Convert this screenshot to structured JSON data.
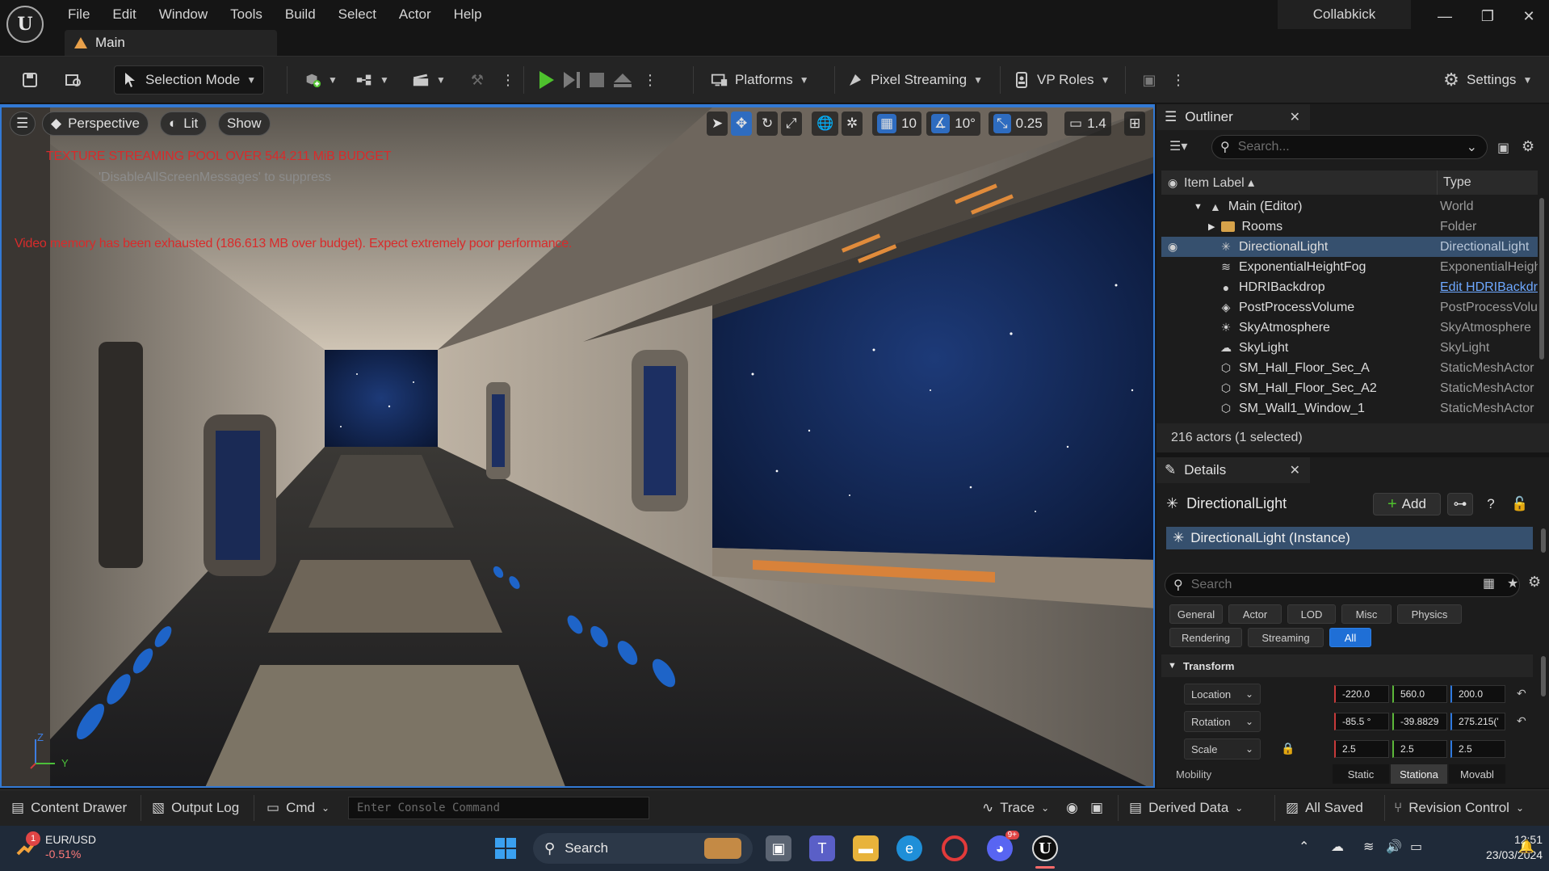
{
  "window": {
    "project_name": "Collabkick",
    "map_tab": "Main",
    "controls": {
      "minimize": "—",
      "maximize": "❐",
      "close": "✕"
    }
  },
  "menu": [
    "File",
    "Edit",
    "Window",
    "Tools",
    "Build",
    "Select",
    "Actor",
    "Help"
  ],
  "toolbar": {
    "selection_mode": "Selection Mode",
    "platforms": "Platforms",
    "pixel_streaming": "Pixel Streaming",
    "vp_roles": "VP Roles",
    "settings": "Settings"
  },
  "viewport": {
    "perspective": "Perspective",
    "lit": "Lit",
    "show": "Show",
    "grid_snap": "10",
    "rotation_snap": "10°",
    "scale_snap": "0.25",
    "camera_speed": "1.4",
    "warning_texture": "TEXTURE STREAMING POOL OVER 544.211 MiB BUDGET",
    "warning_suppress": "'DisableAllScreenMessages' to suppress",
    "warning_memory": "Video memory has been exhausted (186.613 MB over budget). Expect extremely poor performance.",
    "axis_z": "Z",
    "axis_y": "Y"
  },
  "outliner": {
    "tab": "Outliner",
    "close": "✕",
    "search_placeholder": "Search...",
    "col_label": "Item Label ▴",
    "col_type": "Type",
    "rows": [
      {
        "label": "Main (Editor)",
        "type": "World",
        "icon": "level-icon"
      },
      {
        "label": "Rooms",
        "type": "Folder",
        "icon": "folder-icon"
      },
      {
        "label": "DirectionalLight",
        "type": "DirectionalLight",
        "icon": "sun-icon"
      },
      {
        "label": "ExponentialHeightFog",
        "type": "ExponentialHeightFog",
        "icon": "fog-icon"
      },
      {
        "label": "HDRIBackdrop",
        "type": "Edit HDRIBackdrop",
        "icon": "sphere-icon"
      },
      {
        "label": "PostProcessVolume",
        "type": "PostProcessVolume",
        "icon": "volume-icon"
      },
      {
        "label": "SkyAtmosphere",
        "type": "SkyAtmosphere",
        "icon": "atmosphere-icon"
      },
      {
        "label": "SkyLight",
        "type": "SkyLight",
        "icon": "skylight-icon"
      },
      {
        "label": "SM_Hall_Floor_Sec_A",
        "type": "StaticMeshActor",
        "icon": "mesh-icon"
      },
      {
        "label": "SM_Hall_Floor_Sec_A2",
        "type": "StaticMeshActor",
        "icon": "mesh-icon"
      },
      {
        "label": "SM_Wall1_Window_1",
        "type": "StaticMeshActor",
        "icon": "mesh-icon"
      }
    ],
    "footer": "216 actors (1 selected)"
  },
  "details": {
    "tab": "Details",
    "close": "✕",
    "actor_name": "DirectionalLight",
    "add_label": "Add",
    "component": "DirectionalLight (Instance)",
    "search_placeholder": "Search",
    "categories_row1": [
      "General",
      "Actor",
      "LOD",
      "Misc",
      "Physics"
    ],
    "categories_row2": [
      "Rendering",
      "Streaming",
      "All"
    ],
    "section": "Transform",
    "location_label": "Location",
    "location": [
      "-220.0",
      "560.0",
      "200.0"
    ],
    "rotation_label": "Rotation",
    "rotation": [
      "-85.5 °",
      "-39.8829",
      "275.215('"
    ],
    "scale_label": "Scale",
    "scale": [
      "2.5",
      "2.5",
      "2.5"
    ],
    "mobility_label": "Mobility",
    "mobility_options": [
      "Static",
      "Stationa",
      "Movabl"
    ]
  },
  "statusbar": {
    "content_drawer": "Content Drawer",
    "output_log": "Output Log",
    "cmd": "Cmd",
    "console_placeholder": "Enter Console Command",
    "trace": "Trace",
    "derived_data": "Derived Data",
    "all_saved": "All Saved",
    "revision_control": "Revision Control"
  },
  "taskbar": {
    "ticker_name": "EUR/USD",
    "ticker_change": "-0.51%",
    "ticker_badge": "1",
    "search": "Search",
    "discord_badge": "9+",
    "time": "12:51",
    "date": "23/03/2024"
  }
}
